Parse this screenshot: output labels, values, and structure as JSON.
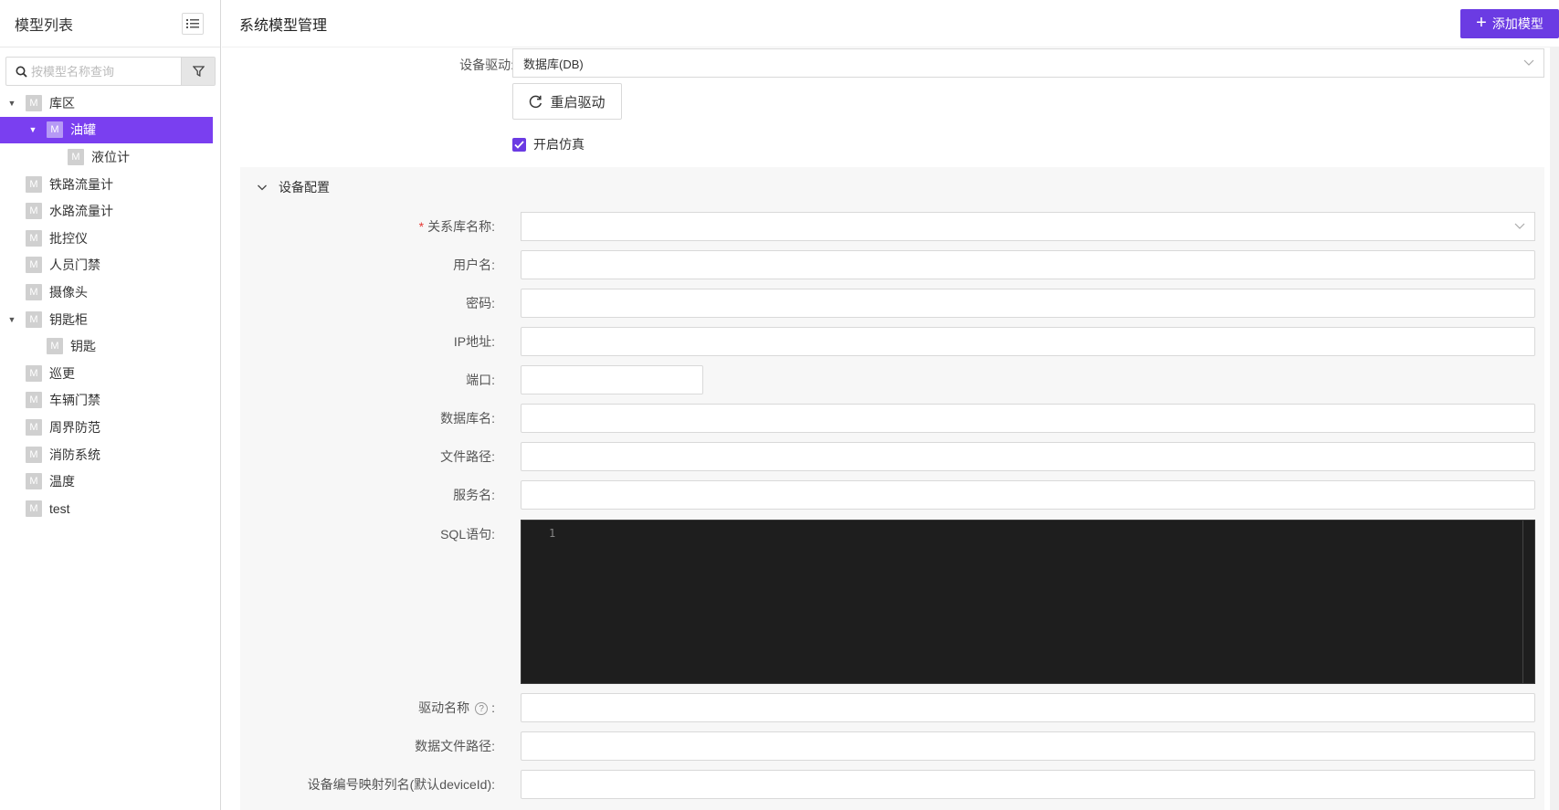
{
  "sidebar": {
    "title": "模型列表",
    "search_placeholder": "按模型名称查询",
    "tree": [
      {
        "label": "库区",
        "level": 0,
        "expandable": true
      },
      {
        "label": "油罐",
        "level": 1,
        "expandable": true,
        "selected": true
      },
      {
        "label": "液位计",
        "level": 2,
        "expandable": false
      },
      {
        "label": "铁路流量计",
        "level": 0,
        "expandable": false
      },
      {
        "label": "水路流量计",
        "level": 0,
        "expandable": false
      },
      {
        "label": "批控仪",
        "level": 0,
        "expandable": false
      },
      {
        "label": "人员门禁",
        "level": 0,
        "expandable": false
      },
      {
        "label": "摄像头",
        "level": 0,
        "expandable": false
      },
      {
        "label": "钥匙柜",
        "level": 0,
        "expandable": true
      },
      {
        "label": "钥匙",
        "level": 1,
        "expandable": false
      },
      {
        "label": "巡更",
        "level": 0,
        "expandable": false
      },
      {
        "label": "车辆门禁",
        "level": 0,
        "expandable": false
      },
      {
        "label": "周界防范",
        "level": 0,
        "expandable": false
      },
      {
        "label": "消防系统",
        "level": 0,
        "expandable": false
      },
      {
        "label": "温度",
        "level": 0,
        "expandable": false
      },
      {
        "label": "test",
        "level": 0,
        "expandable": false
      }
    ],
    "badge": "M"
  },
  "header": {
    "title": "系统模型管理",
    "add_button": "添加模型"
  },
  "driver": {
    "label": "设备驱动:",
    "value": "数据库(DB)",
    "restart_button": "重启驱动",
    "simulate_label": "开启仿真",
    "simulate_checked": true
  },
  "config": {
    "section_title": "设备配置",
    "fields": {
      "db_name": "关系库名称:",
      "username": "用户名:",
      "password": "密码:",
      "ip": "IP地址:",
      "port": "端口:",
      "database": "数据库名:",
      "file_path": "文件路径:",
      "service": "服务名:",
      "sql": "SQL语句:",
      "driver_name": "驱动名称",
      "driver_colon": ":",
      "data_file_path": "数据文件路径:",
      "device_map": "设备编号映射列名(默认deviceId):"
    },
    "required_mark": "*",
    "editor_line": "1"
  },
  "colors": {
    "accent": "#6b3be3",
    "selected_bg": "#7a3ff0",
    "editor_bg": "#1e1e1e"
  }
}
